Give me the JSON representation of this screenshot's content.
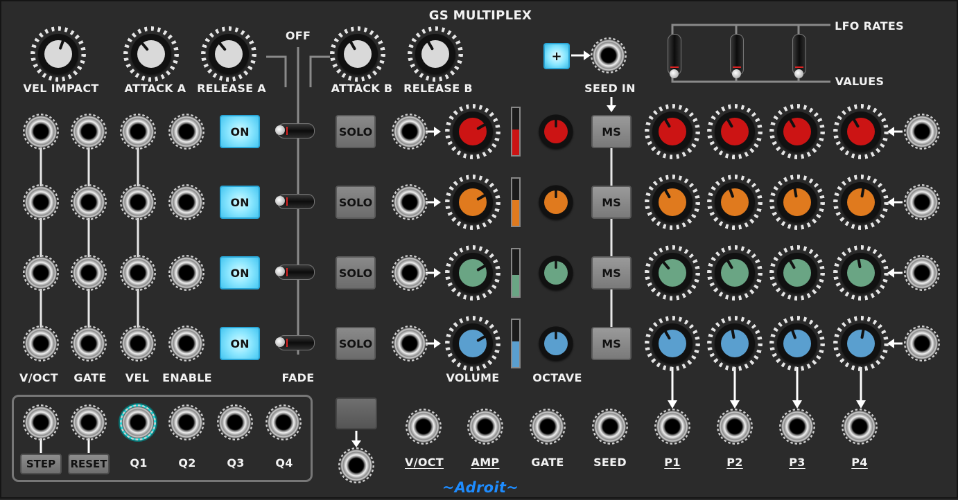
{
  "title": "GS MULTIPLEX",
  "brand": "~Adroit~",
  "top_knob_labels": [
    "VEL IMPACT",
    "ATTACK A",
    "RELEASE A",
    "ATTACK B",
    "RELEASE B"
  ],
  "fade_off_label": "OFF",
  "seed_in_label": "SEED IN",
  "plus_label": "+",
  "lfo_labels": {
    "rates": "LFO RATES",
    "values": "VALUES"
  },
  "left_col_labels": [
    "V/OCT",
    "GATE",
    "VEL",
    "ENABLE"
  ],
  "fade_label": "FADE",
  "on_label": "ON",
  "solo_label": "SOLO",
  "ms_label": "MS",
  "volume_label": "VOLUME",
  "octave_label": "OCTAVE",
  "q_box": {
    "step": "STEP",
    "reset": "RESET",
    "outputs": [
      "Q1",
      "Q2",
      "Q3",
      "Q4"
    ]
  },
  "bottom_outputs": [
    "V/OCT",
    "AMP",
    "GATE",
    "SEED",
    "P1",
    "P2",
    "P3",
    "P4"
  ],
  "row_colors": [
    "#cc1414",
    "#e07a1e",
    "#6aa584",
    "#5a9fcf"
  ],
  "volume_levels": [
    0.55,
    0.55,
    0.45,
    0.55
  ]
}
